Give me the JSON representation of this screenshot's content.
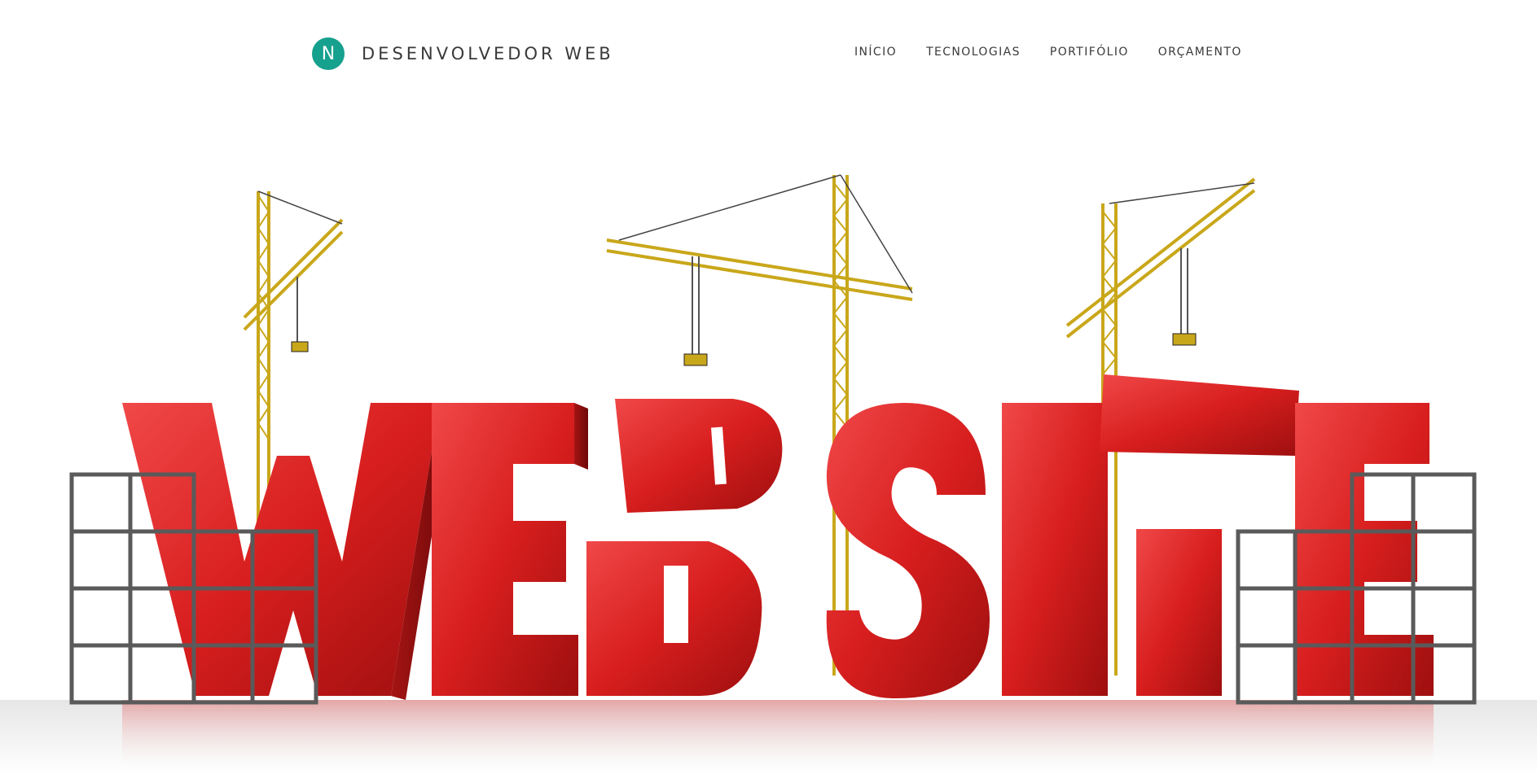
{
  "brand": {
    "logo_letter": "N",
    "name": "DESENVOLVEDOR WEB",
    "accent_color": "#16a08e"
  },
  "nav": {
    "items": [
      {
        "label": "INÍCIO"
      },
      {
        "label": "TECNOLOGIAS"
      },
      {
        "label": "PORTIFÓLIO"
      },
      {
        "label": "ORÇAMENTO"
      }
    ]
  },
  "hero": {
    "image": "hero-website-construction-illustration",
    "letters_color": "#d81e1e",
    "crane_color": "#c9a71a",
    "scaffold_color": "#5a5a5a"
  }
}
